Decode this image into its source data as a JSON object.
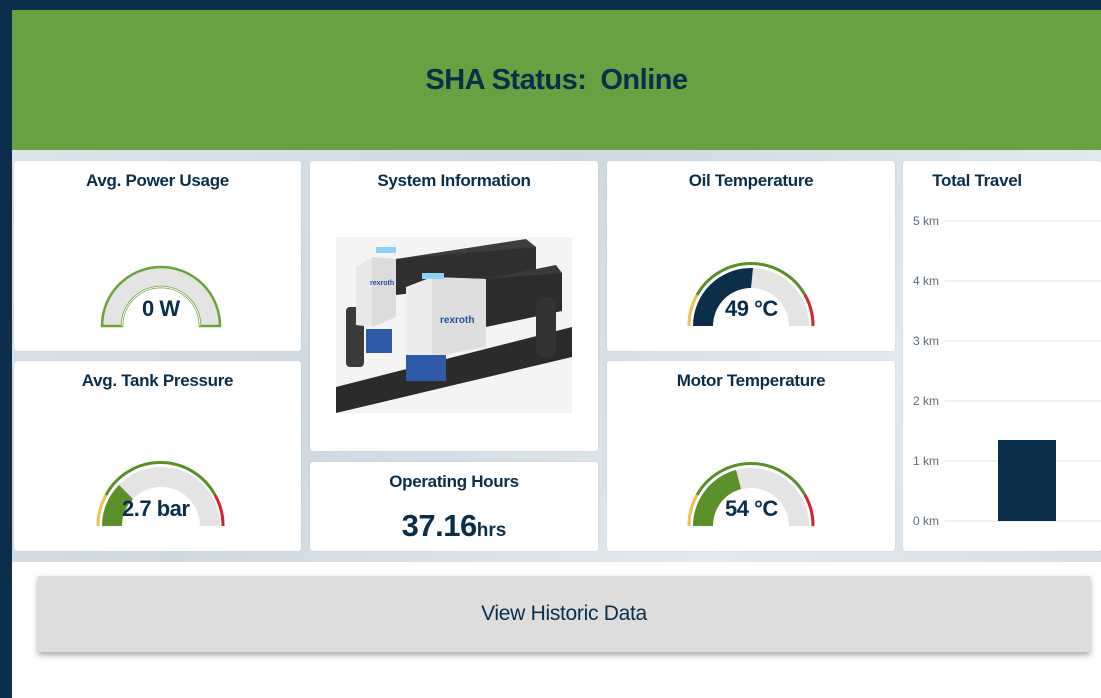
{
  "header": {
    "status_label": "SHA Status:",
    "status_value": "Online"
  },
  "cards": {
    "power": {
      "title": "Avg. Power Usage",
      "value": "0 W",
      "fraction": 0.0
    },
    "pressure": {
      "title": "Avg. Tank Pressure",
      "value": "2.7 bar",
      "fraction": 0.27
    },
    "system": {
      "title": "System Information",
      "image": "product-image",
      "brand": "rexroth"
    },
    "hours": {
      "title": "Operating Hours",
      "value": "37.16",
      "unit": "hrs"
    },
    "oil": {
      "title": "Oil Temperature",
      "value": "49 °C",
      "fraction": 0.49
    },
    "motor": {
      "title": "Motor Temperature",
      "value": "54 °C",
      "fraction": 0.34
    },
    "travel": {
      "title": "Total Travel"
    }
  },
  "chart_data": {
    "type": "bar",
    "title": "Total Travel",
    "categories": [
      ""
    ],
    "values": [
      1.35
    ],
    "yticks": [
      "5 km",
      "4 km",
      "3 km",
      "2 km",
      "1 km",
      "0 km"
    ],
    "ylim": [
      0,
      5
    ],
    "grid": true,
    "bar_color": "#0b2e4a"
  },
  "footer": {
    "button_label": "View Historic Data"
  },
  "colors": {
    "brand_green": "#67a142",
    "navy": "#0b2e4a",
    "gauge_green": "#5a8f2a",
    "gauge_outline_green": "#6aa339",
    "warn_yellow": "#f2c14e",
    "alert_red": "#d6202a",
    "track": "#e4e4e4"
  }
}
